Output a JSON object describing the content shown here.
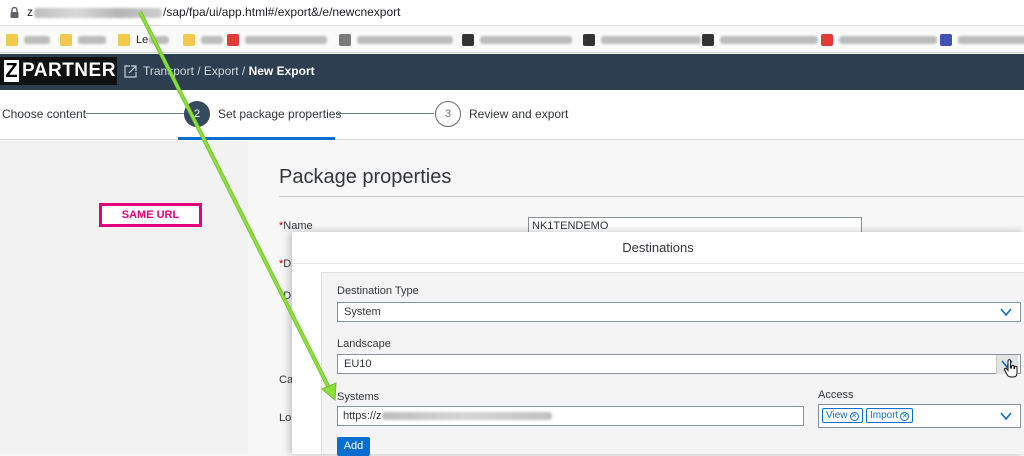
{
  "browser": {
    "url_prefix": "z",
    "url_path": "/sap/fpa/ui/app.html#/export&/e/newcnexport",
    "bookmarks": [
      {
        "label": "",
        "icon": "folder-icon",
        "color": "#f2c94c"
      },
      {
        "label": "",
        "icon": "folder-icon",
        "color": "#f2c94c"
      },
      {
        "label": "Le",
        "icon": "folder-icon",
        "color": "#f2c94c"
      },
      {
        "label": "",
        "icon": "folder-icon",
        "color": "#f2c94c"
      },
      {
        "label": "",
        "icon": "youtube-icon",
        "color": "#e53935"
      },
      {
        "label": "",
        "icon": "page-icon",
        "color": "#7a7a7a"
      },
      {
        "label": "",
        "icon": "page-icon",
        "color": "#333333"
      },
      {
        "label": "",
        "icon": "page-icon",
        "color": "#333333"
      },
      {
        "label": "",
        "icon": "page-icon",
        "color": "#333333"
      },
      {
        "label": "",
        "icon": "youtube-icon",
        "color": "#e53935"
      },
      {
        "label": "",
        "icon": "page-icon",
        "color": "#3f51b5"
      }
    ]
  },
  "shell": {
    "logo_letter": "Z",
    "logo_text": "PARTNER",
    "breadcrumb_path": "Transport / Export / ",
    "breadcrumb_current": "New Export"
  },
  "stepper": {
    "steps": [
      {
        "number": "",
        "label": "Choose content"
      },
      {
        "number": "2",
        "label": "Set package properties"
      },
      {
        "number": "3",
        "label": "Review and export"
      }
    ]
  },
  "package": {
    "title": "Package properties",
    "name_label": "Name",
    "name_value": "NK1TENDEMO",
    "label_d": "D",
    "label_d2": "D",
    "label_ca": "Ca",
    "label_lo": "Lo"
  },
  "annotation": {
    "text": "SAME URL",
    "color": "#e4007c",
    "arrow_color": "#8be03a"
  },
  "dialog": {
    "title": "Destinations",
    "destination_type_label": "Destination Type",
    "destination_type_value": "System",
    "landscape_label": "Landscape",
    "landscape_value": "EU10",
    "systems_label": "Systems",
    "systems_value_prefix": "https://z",
    "access_label": "Access",
    "access_tokens": [
      "View",
      "Import"
    ],
    "add_label": "Add"
  },
  "colors": {
    "shell_bg": "#2c3e50",
    "accent": "#0a6ed1",
    "required": "#bb0000"
  }
}
